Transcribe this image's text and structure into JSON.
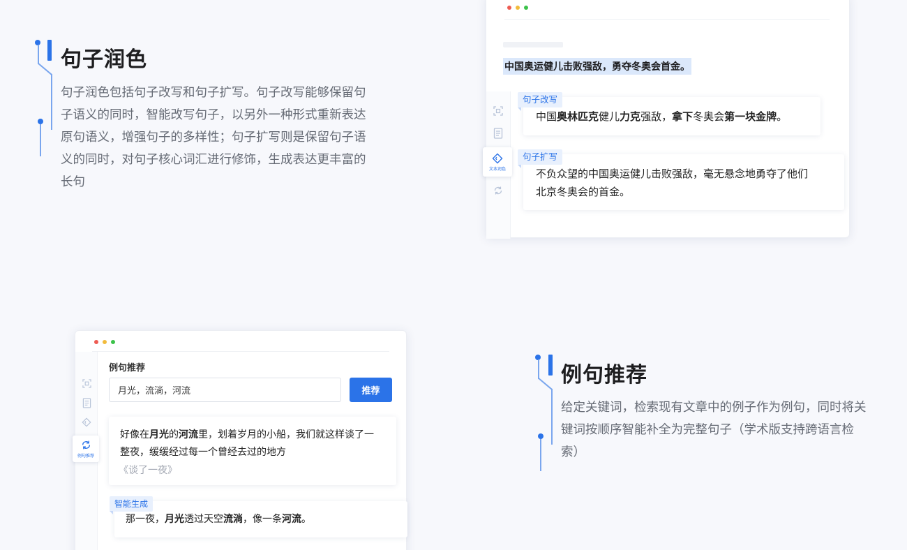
{
  "feature_polish": {
    "title": "句子润色",
    "description": "句子润色包括句子改写和句子扩写。句子改写能够保留句子语义的同时，智能改写句子，以另外一种形式重新表达原句语义，增强句子的多样性；句子扩写则是保留句子语义的同时，对句子核心词汇进行修饰，生成表达更丰富的长句"
  },
  "feature_example": {
    "title": "例句推荐",
    "description": "给定关键词，检索现有文章中的例子作为例句，同时将关键词按顺序智能补全为完整句子（学术版支持跨语言检索）"
  },
  "window_polish": {
    "selected_sentence": "中国奥运健儿击败强敌，勇夺冬奥会首金。",
    "rail_active_label": "文本润色",
    "rewrite": {
      "tag": "句子改写",
      "segments": [
        {
          "t": "中国",
          "b": false
        },
        {
          "t": "奥林匹克",
          "b": true
        },
        {
          "t": "健儿",
          "b": false
        },
        {
          "t": "力克",
          "b": true
        },
        {
          "t": "强敌，",
          "b": false
        },
        {
          "t": "拿下",
          "b": true
        },
        {
          "t": "冬奥会",
          "b": false
        },
        {
          "t": "第一块金牌",
          "b": true
        },
        {
          "t": "。",
          "b": false
        }
      ]
    },
    "expand": {
      "tag": "句子扩写",
      "line1": "不负众望的中国奥运健儿击败强敌，毫无悬念地勇夺了他们",
      "line2": "北京冬奥会的首金。"
    }
  },
  "window_example": {
    "section_label": "例句推荐",
    "search_value": "月光，流淌，河流",
    "button_label": "推荐",
    "rail_active_label": "例句推荐",
    "result": {
      "line1_segments": [
        {
          "t": "好像在",
          "b": false
        },
        {
          "t": "月光",
          "b": true
        },
        {
          "t": "的",
          "b": false
        },
        {
          "t": "河流",
          "b": true
        },
        {
          "t": "里，划着岁月的小船，我们就这样谈了一",
          "b": false
        }
      ],
      "line2": "整夜，缓缓经过每一个曾经去过的地方",
      "source": "《谈了一夜》"
    },
    "generated": {
      "tag": "智能生成",
      "segments": [
        {
          "t": "那一夜，",
          "b": false
        },
        {
          "t": "月光",
          "b": true
        },
        {
          "t": "透过天空",
          "b": false
        },
        {
          "t": "流淌",
          "b": true
        },
        {
          "t": "，像一条",
          "b": false
        },
        {
          "t": "河流",
          "b": true
        },
        {
          "t": "。",
          "b": false
        }
      ]
    }
  },
  "colors": {
    "accent": "#2b73e8",
    "tag_bg": "#e8f0fd",
    "highlight": "#dbe8fb"
  }
}
